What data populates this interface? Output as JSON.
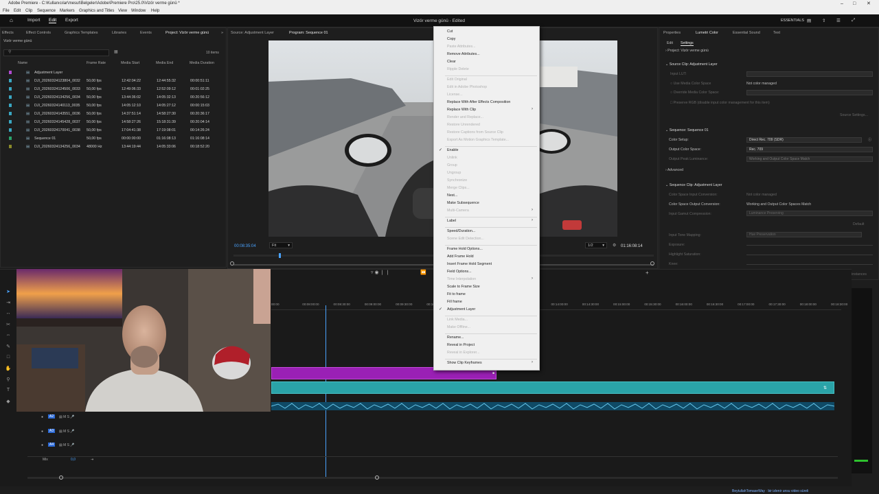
{
  "window": {
    "title": "Adobe Premiere - C:\\Kullanıcılar\\mesut\\Belgeler\\Adobe\\Premiere Pro\\25.0\\Vizör verme günü *"
  },
  "menubar": [
    "File",
    "Edit",
    "Clip",
    "Sequence",
    "Markers",
    "Graphics and Titles",
    "View",
    "Window",
    "Help"
  ],
  "topbar": {
    "tabs": [
      "Import",
      "Edit",
      "Export"
    ],
    "active_tab": "Edit",
    "doc_title": "Vizör verme günü - Edited",
    "workspace": "ESSENTIALS"
  },
  "project_panel": {
    "tabs": [
      "Effects",
      "Effect Controls",
      "Graphics Templates",
      "Libraries",
      "Events",
      "Project: Vizör verme günü"
    ],
    "breadcrumb": "Vizör verme günü",
    "item_count": "10 items",
    "columns": [
      "Name",
      "Frame Rate",
      "Media Start",
      "Media End",
      "Media Duration"
    ],
    "rows": [
      {
        "name": "Adjustment Layer",
        "rate": "",
        "start": "",
        "end": "",
        "dur": "",
        "color": "#b14bd1"
      },
      {
        "name": "DJI_20260324123804_0032",
        "rate": "50,00 fps",
        "start": "12:42:04:22",
        "end": "12:44:55:32",
        "dur": "00:00:51:11",
        "color": "#3aa7c2"
      },
      {
        "name": "DJI_20260324124506_0033",
        "rate": "50,00 fps",
        "start": "12:49:06:33",
        "end": "12:52:09:12",
        "dur": "00:01:02:25",
        "color": "#3aa7c2"
      },
      {
        "name": "DJI_20260324134256_0034",
        "rate": "50,00 fps",
        "start": "13:44:36:02",
        "end": "14:05:32:13",
        "dur": "00:20:56:12",
        "color": "#3aa7c2"
      },
      {
        "name": "DJI_20260324140113_0035",
        "rate": "50,00 fps",
        "start": "14:05:12:10",
        "end": "14:05:27:12",
        "dur": "00:00:15:03",
        "color": "#3aa7c2"
      },
      {
        "name": "DJI_20260324143551_0036",
        "rate": "50,00 fps",
        "start": "14:37:51:14",
        "end": "14:58:27:30",
        "dur": "00:20:36:17",
        "color": "#3aa7c2"
      },
      {
        "name": "DJI_20260324145428_0037",
        "rate": "50,00 fps",
        "start": "14:58:27:26",
        "end": "15:18:31:39",
        "dur": "00:20:04:14",
        "color": "#3aa7c2"
      },
      {
        "name": "DJI_20260324170041_0038",
        "rate": "50,00 fps",
        "start": "17:04:41:38",
        "end": "17:19:08:01",
        "dur": "00:14:26:24",
        "color": "#3aa7c2"
      },
      {
        "name": "Sequence 01",
        "rate": "50,00 fps",
        "start": "00:00:00:00",
        "end": "01:16:08:13",
        "dur": "01:16:08:14",
        "color": "#2aa36b"
      },
      {
        "name": "DJI_20260324134256_0034",
        "rate": "48000 Hz",
        "start": "13:44:19:44",
        "end": "14:05:33:06",
        "dur": "00:18:52:20",
        "color": "#8a8a2a"
      }
    ]
  },
  "monitor": {
    "tabs": [
      "Source: Adjustment Layer",
      "Program: Sequence 01"
    ],
    "timecode_left": "00:08:35:04",
    "fit": "Fit",
    "quality": "1/2",
    "timecode_right": "01:16:08:14"
  },
  "context_menu": {
    "items": [
      {
        "label": "Cut",
        "enabled": true
      },
      {
        "label": "Copy",
        "enabled": true
      },
      {
        "label": "Paste Attributes...",
        "enabled": false
      },
      {
        "label": "Remove Attributes...",
        "enabled": true
      },
      {
        "label": "Clear",
        "enabled": true
      },
      {
        "label": "Ripple Delete",
        "enabled": false
      },
      {
        "sep": true
      },
      {
        "label": "Edit Original",
        "enabled": false
      },
      {
        "label": "Edit in Adobe Photoshop",
        "enabled": false
      },
      {
        "label": "License...",
        "enabled": false
      },
      {
        "label": "Replace With After Effects Composition",
        "enabled": true
      },
      {
        "label": "Replace With Clip",
        "enabled": true,
        "submenu": true
      },
      {
        "label": "Render and Replace...",
        "enabled": false
      },
      {
        "label": "Restore Unrendered",
        "enabled": false
      },
      {
        "label": "Restore Captions from Source Clip",
        "enabled": false
      },
      {
        "label": "Export As Motion Graphics Template...",
        "enabled": false
      },
      {
        "sep": true
      },
      {
        "label": "Enable",
        "enabled": true,
        "checked": true
      },
      {
        "label": "Unlink",
        "enabled": false
      },
      {
        "label": "Group",
        "enabled": false
      },
      {
        "label": "Ungroup",
        "enabled": false
      },
      {
        "label": "Synchronize",
        "enabled": false
      },
      {
        "label": "Merge Clips...",
        "enabled": false
      },
      {
        "label": "Nest...",
        "enabled": true
      },
      {
        "label": "Make Subsequence",
        "enabled": true
      },
      {
        "label": "Multi-Camera",
        "enabled": false,
        "submenu": true
      },
      {
        "sep": true
      },
      {
        "label": "Label",
        "enabled": true,
        "submenu": true
      },
      {
        "sep": true
      },
      {
        "label": "Speed/Duration...",
        "enabled": true
      },
      {
        "label": "Scene Edit Detection...",
        "enabled": false
      },
      {
        "sep": true
      },
      {
        "label": "Frame Hold Options...",
        "enabled": true
      },
      {
        "label": "Add Frame Hold",
        "enabled": true
      },
      {
        "label": "Insert Frame Hold Segment",
        "enabled": true
      },
      {
        "label": "Field Options...",
        "enabled": true
      },
      {
        "label": "Time Interpolation",
        "enabled": false,
        "submenu": true
      },
      {
        "label": "Scale to Frame Size",
        "enabled": true
      },
      {
        "label": "Fit to frame",
        "enabled": true
      },
      {
        "label": "Fill frame",
        "enabled": true
      },
      {
        "label": "Adjustment Layer",
        "enabled": true,
        "checked": true
      },
      {
        "sep": true
      },
      {
        "label": "Link Media...",
        "enabled": false
      },
      {
        "label": "Make Offline...",
        "enabled": false
      },
      {
        "sep": true
      },
      {
        "label": "Rename...",
        "enabled": true
      },
      {
        "label": "Reveal in Project",
        "enabled": true
      },
      {
        "label": "Reveal in Explorer...",
        "enabled": false
      },
      {
        "sep": true
      },
      {
        "label": "Show Clip Keyframes",
        "enabled": true,
        "submenu": true
      }
    ]
  },
  "right_panel": {
    "tabs": [
      "Properties",
      "Lumetri Color",
      "Essential Sound",
      "Text"
    ],
    "subtabs": [
      "Edit",
      "Settings"
    ],
    "project_label": "Project: Vizör verme günü",
    "source_clip_label": "Source Clip: Adjustment Layer",
    "input_lut_label": "Input LUT:",
    "use_media_color_space": "Use Media Color Space",
    "not_color_managed": "Not color managed",
    "override_media_color_space": "Override Media Color Space:",
    "preserve_rgb": "Preserve RGB (disable input color management for this item)",
    "source_settings": "Source Settings...",
    "sequence_label": "Sequence: Sequence 01",
    "color_setup_label": "Color Setup:",
    "color_setup_value": "Direct Rec. 709 (SDR)",
    "output_color_space_label": "Output Color Space:",
    "output_color_space_value": "Rec. 709",
    "output_peak_label": "Output Peak Luminance:",
    "output_peak_value": "Working and Output Color Space Match",
    "advanced": "Advanced",
    "seq_clip_label": "Sequence Clip: Adjustment Layer",
    "input_conversion_label": "Color Space Input Conversion:",
    "input_conversion_value": "Not color managed",
    "output_conversion_label": "Color Space Output Conversion:",
    "output_conversion_value": "Working and Output Color Spaces Match",
    "gamut_label": "Input Gamut Compression:",
    "gamut_value": "Luminance Preserving",
    "default_button": "Default",
    "tone_mapping_label": "Input Tone Mapping:",
    "tone_mapping_value": "Hue Preservation",
    "exposure": "Exposure:",
    "highlight_saturation": "Highlight Saturation:",
    "knee": "Knee:",
    "apply_all": "Apply to all clip instances"
  },
  "timeline": {
    "ruler": [
      "00:00",
      "00:08:00:00",
      "00:08:30:00",
      "00:09:00:00",
      "00:09:30:00",
      "00:10:00:00",
      "00:10:30:00",
      "00:13:00:00",
      "00:13:30:00",
      "00:14:00:00",
      "00:14:30:00",
      "00:15:00:00",
      "00:15:30:00",
      "00:16:00:00",
      "00:16:30:00",
      "00:17:00:00",
      "00:17:30:00",
      "00:18:00:00",
      "00:18:30:00"
    ],
    "audio_tracks": [
      "A2",
      "A3",
      "A4"
    ],
    "mix_label": "Mix",
    "mix_value": "0,0"
  },
  "watermark": "BeytullahTomaseWay · bir izlenir unsu video süreli"
}
